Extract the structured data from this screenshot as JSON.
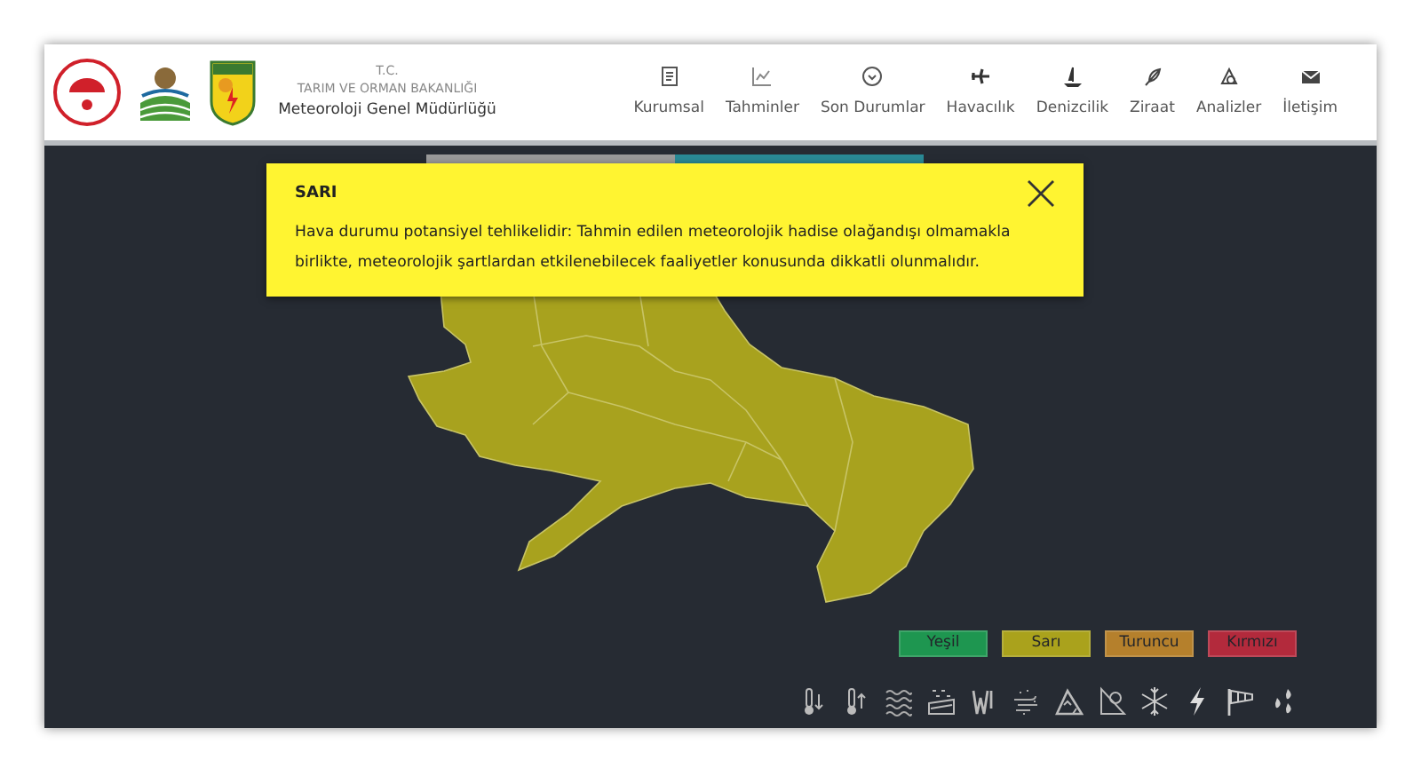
{
  "header": {
    "subtitle_1": "T.C.",
    "subtitle_2": "TARIM VE ORMAN BAKANLIĞI",
    "title": "Meteoroloji Genel Müdürlüğü"
  },
  "nav": [
    {
      "label": "Kurumsal",
      "kind": "document"
    },
    {
      "label": "Tahminler",
      "kind": "chart"
    },
    {
      "label": "Son Durumlar",
      "kind": "check"
    },
    {
      "label": "Havacılık",
      "kind": "plane"
    },
    {
      "label": "Denizcilik",
      "kind": "ship"
    },
    {
      "label": "Ziraat",
      "kind": "leaf"
    },
    {
      "label": "Analizler",
      "kind": "analysis"
    },
    {
      "label": "İletişim",
      "kind": "mail"
    }
  ],
  "alert": {
    "title": "SARI",
    "text": "Hava durumu potansiyel tehlikelidir: Tahmin edilen meteorolojik hadise olağandışı olmamakla birlikte, meteorolojik şartlardan etkilenebilecek faaliyetler konusunda dikkatli olunmalıdır."
  },
  "legend": [
    {
      "label": "Yeşil",
      "color": "#1e9650"
    },
    {
      "label": "Sarı",
      "color": "#aaa21c"
    },
    {
      "label": "Turuncu",
      "color": "#b5802c"
    },
    {
      "label": "Kırmızı",
      "color": "#b32a3c"
    }
  ],
  "hazards": [
    {
      "kind": "cold"
    },
    {
      "kind": "hot"
    },
    {
      "kind": "fog"
    },
    {
      "kind": "snow-rain"
    },
    {
      "kind": "wind"
    },
    {
      "kind": "dust"
    },
    {
      "kind": "avalanche"
    },
    {
      "kind": "landslide"
    },
    {
      "kind": "frost"
    },
    {
      "kind": "lightning"
    },
    {
      "kind": "windsock"
    },
    {
      "kind": "rain"
    }
  ]
}
